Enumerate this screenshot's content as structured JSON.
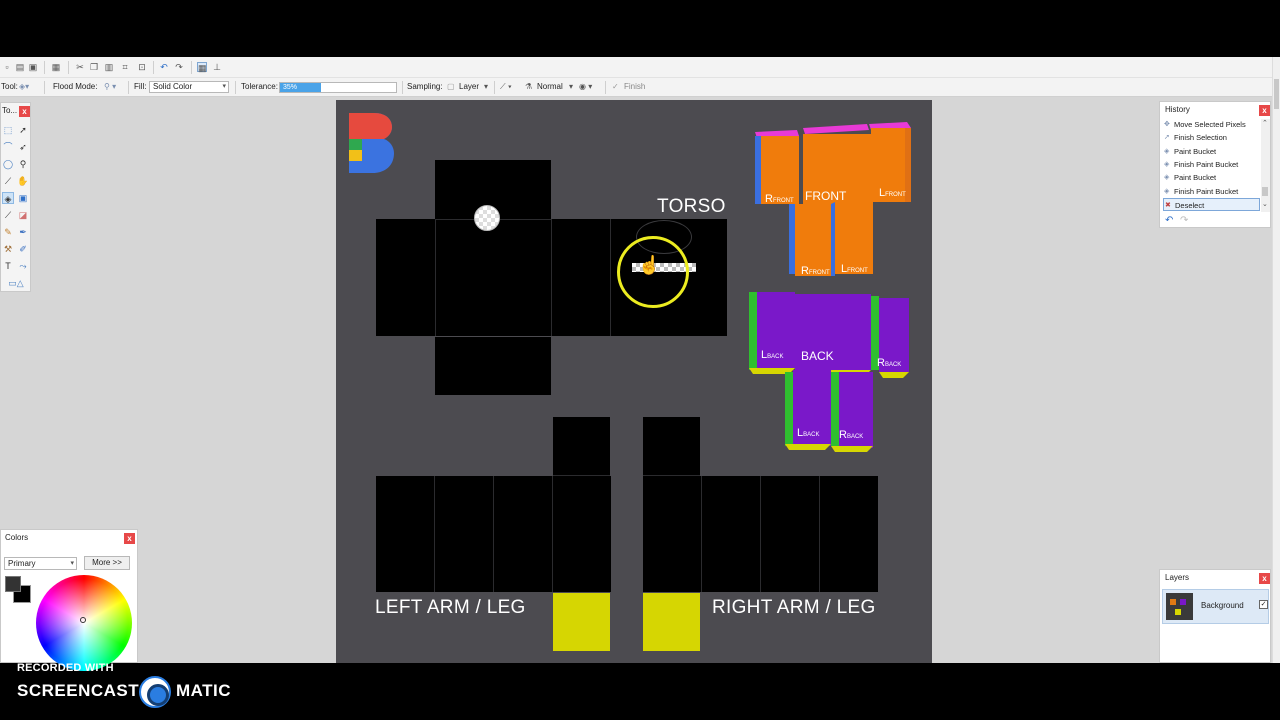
{
  "toolbar": {
    "tool_label": "Tool:",
    "flood_mode_label": "Flood Mode:",
    "fill_label": "Fill:",
    "fill_value": "Solid Color",
    "tolerance_label": "Tolerance:",
    "tolerance_value": "35%",
    "tolerance_fraction": 0.35,
    "sampling_label": "Sampling:",
    "sampling_value": "Layer",
    "blend_value": "Normal",
    "finish_label": "Finish"
  },
  "canvas": {
    "torso_label": "TORSO",
    "left_label": "LEFT ARM / LEG",
    "right_label": "RIGHT ARM / LEG",
    "front_label": "FRONT",
    "back_label": "BACK",
    "front_letters": {
      "r": "R",
      "r_sub": "FRONT",
      "l": "L",
      "l_sub": "FRONT"
    },
    "back_letters": {
      "r": "R",
      "r_sub": "BACK",
      "l": "L",
      "l_sub": "BACK"
    },
    "colors": {
      "canvas_bg": "#4c4b50",
      "black": "#000000",
      "yellow": "#d6d602",
      "orange": "#f07c0c",
      "purple": "#7a18c9",
      "blue": "#3a6fe0",
      "pink": "#e83ad6",
      "green": "#2fbf2f",
      "cursor_ring": "#ecec20"
    }
  },
  "tools_panel": {
    "title": "To..."
  },
  "history": {
    "title": "History",
    "items": [
      "Move Selected Pixels",
      "Finish Selection",
      "Paint Bucket",
      "Finish Paint Bucket",
      "Paint Bucket",
      "Finish Paint Bucket",
      "Deselect"
    ],
    "selected_index": 6
  },
  "colors_panel": {
    "title": "Colors",
    "mode": "Primary",
    "more_button": "More >>"
  },
  "layers": {
    "title": "Layers",
    "items": [
      {
        "name": "Background",
        "visible": true
      }
    ]
  },
  "watermark": {
    "small": "RECORDED WITH",
    "left": "SCREENCAST",
    "right": "MATIC"
  }
}
